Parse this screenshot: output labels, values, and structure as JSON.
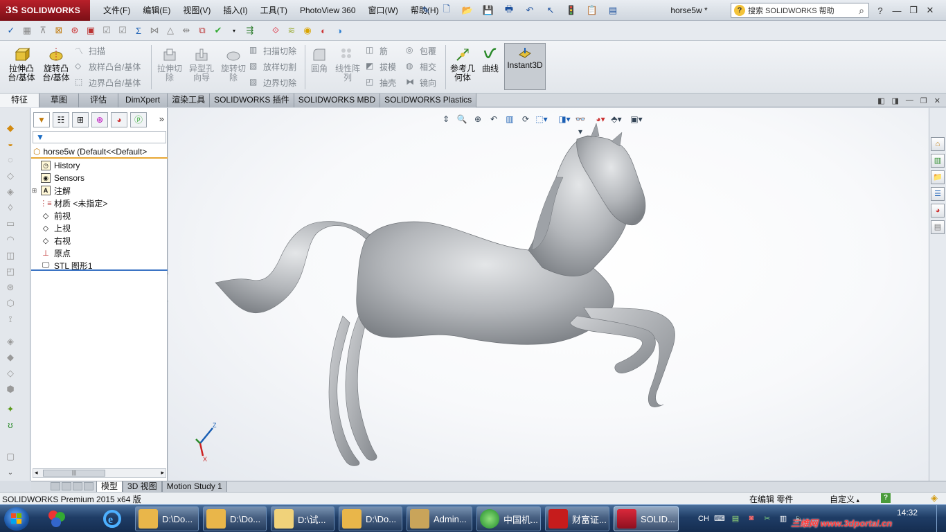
{
  "app": {
    "logo_prefix": "3S",
    "logo_name": "SOLIDWORKS",
    "document_title": "horse5w *"
  },
  "menu": [
    "文件(F)",
    "编辑(E)",
    "视图(V)",
    "插入(I)",
    "工具(T)",
    "PhotoView 360",
    "窗口(W)",
    "帮助(H)"
  ],
  "help_search": {
    "placeholder": "搜索 SOLIDWORKS 帮助"
  },
  "ribbon": {
    "extrude_boss": "拉伸凸\n台/基体",
    "revolve_boss": "旋转凸\n台/基体",
    "sweep": "扫描",
    "loft_boss": "放样凸台/基体",
    "boundary_boss": "边界凸台/基体",
    "extrude_cut": "拉伸切\n除",
    "hole_wizard": "异型孔\n向导",
    "revolve_cut": "旋转切\n除",
    "swept_cut": "扫描切除",
    "lofted_cut": "放样切割",
    "boundary_cut": "边界切除",
    "fillet": "圆角",
    "linear_pattern": "线性阵\n列",
    "rib": "筋",
    "draft": "拔模",
    "shell": "抽壳",
    "wrap": "包覆",
    "intersect": "相交",
    "mirror": "镜向",
    "reference_geometry": "参考几\n何体",
    "curves": "曲线",
    "instant3d": "Instant3D"
  },
  "tabs": [
    "特征",
    "草图",
    "评估",
    "DimXpert",
    "渲染工具",
    "SOLIDWORKS 插件",
    "SOLIDWORKS MBD",
    "SOLIDWORKS Plastics"
  ],
  "feature_tree": {
    "root": "horse5w  (Default<<Default>",
    "nodes": [
      {
        "label": "History",
        "icon": "history-icon",
        "expandable": false
      },
      {
        "label": "Sensors",
        "icon": "sensors-icon",
        "expandable": false
      },
      {
        "label": "注解",
        "icon": "annotations-icon",
        "expandable": true
      },
      {
        "label": "材质 <未指定>",
        "icon": "material-icon",
        "expandable": false
      },
      {
        "label": "前视",
        "icon": "plane-icon",
        "expandable": false
      },
      {
        "label": "上视",
        "icon": "plane-icon",
        "expandable": false
      },
      {
        "label": "右视",
        "icon": "plane-icon",
        "expandable": false
      },
      {
        "label": "原点",
        "icon": "origin-icon",
        "expandable": false
      },
      {
        "label": "STL 图形1",
        "icon": "stl-graphics-icon",
        "expandable": false
      }
    ]
  },
  "bottom_tabs": [
    "模型",
    "3D 视图",
    "Motion Study 1"
  ],
  "triad": {
    "z": "Z",
    "x": "X"
  },
  "status": {
    "product": "SOLIDWORKS Premium 2015 x64 版",
    "mode": "在编辑 零件",
    "units": "自定义"
  },
  "taskbar": {
    "buttons": [
      {
        "label": "D:\\Do...",
        "icon": "folder-icon"
      },
      {
        "label": "D:\\Do...",
        "icon": "folder-icon"
      },
      {
        "label": "D:\\试...",
        "icon": "folder-icon"
      },
      {
        "label": "D:\\Do...",
        "icon": "folder-icon"
      },
      {
        "label": "Admin...",
        "icon": "user-folder-icon"
      },
      {
        "label": "中国机...",
        "icon": "browser-icon"
      },
      {
        "label": "财富证...",
        "icon": "cfzq-icon"
      },
      {
        "label": "SOLID...",
        "icon": "solidworks-icon"
      }
    ],
    "tray_language": "CH",
    "clock": "14:32",
    "watermark": "三维网 www.3dportal.cn"
  },
  "colors": {
    "logo_red": "#9b1a22",
    "accent_orange": "#e8a632",
    "taskbar_blue": "#1f3d66",
    "model_gray": "#b4b7bb"
  }
}
